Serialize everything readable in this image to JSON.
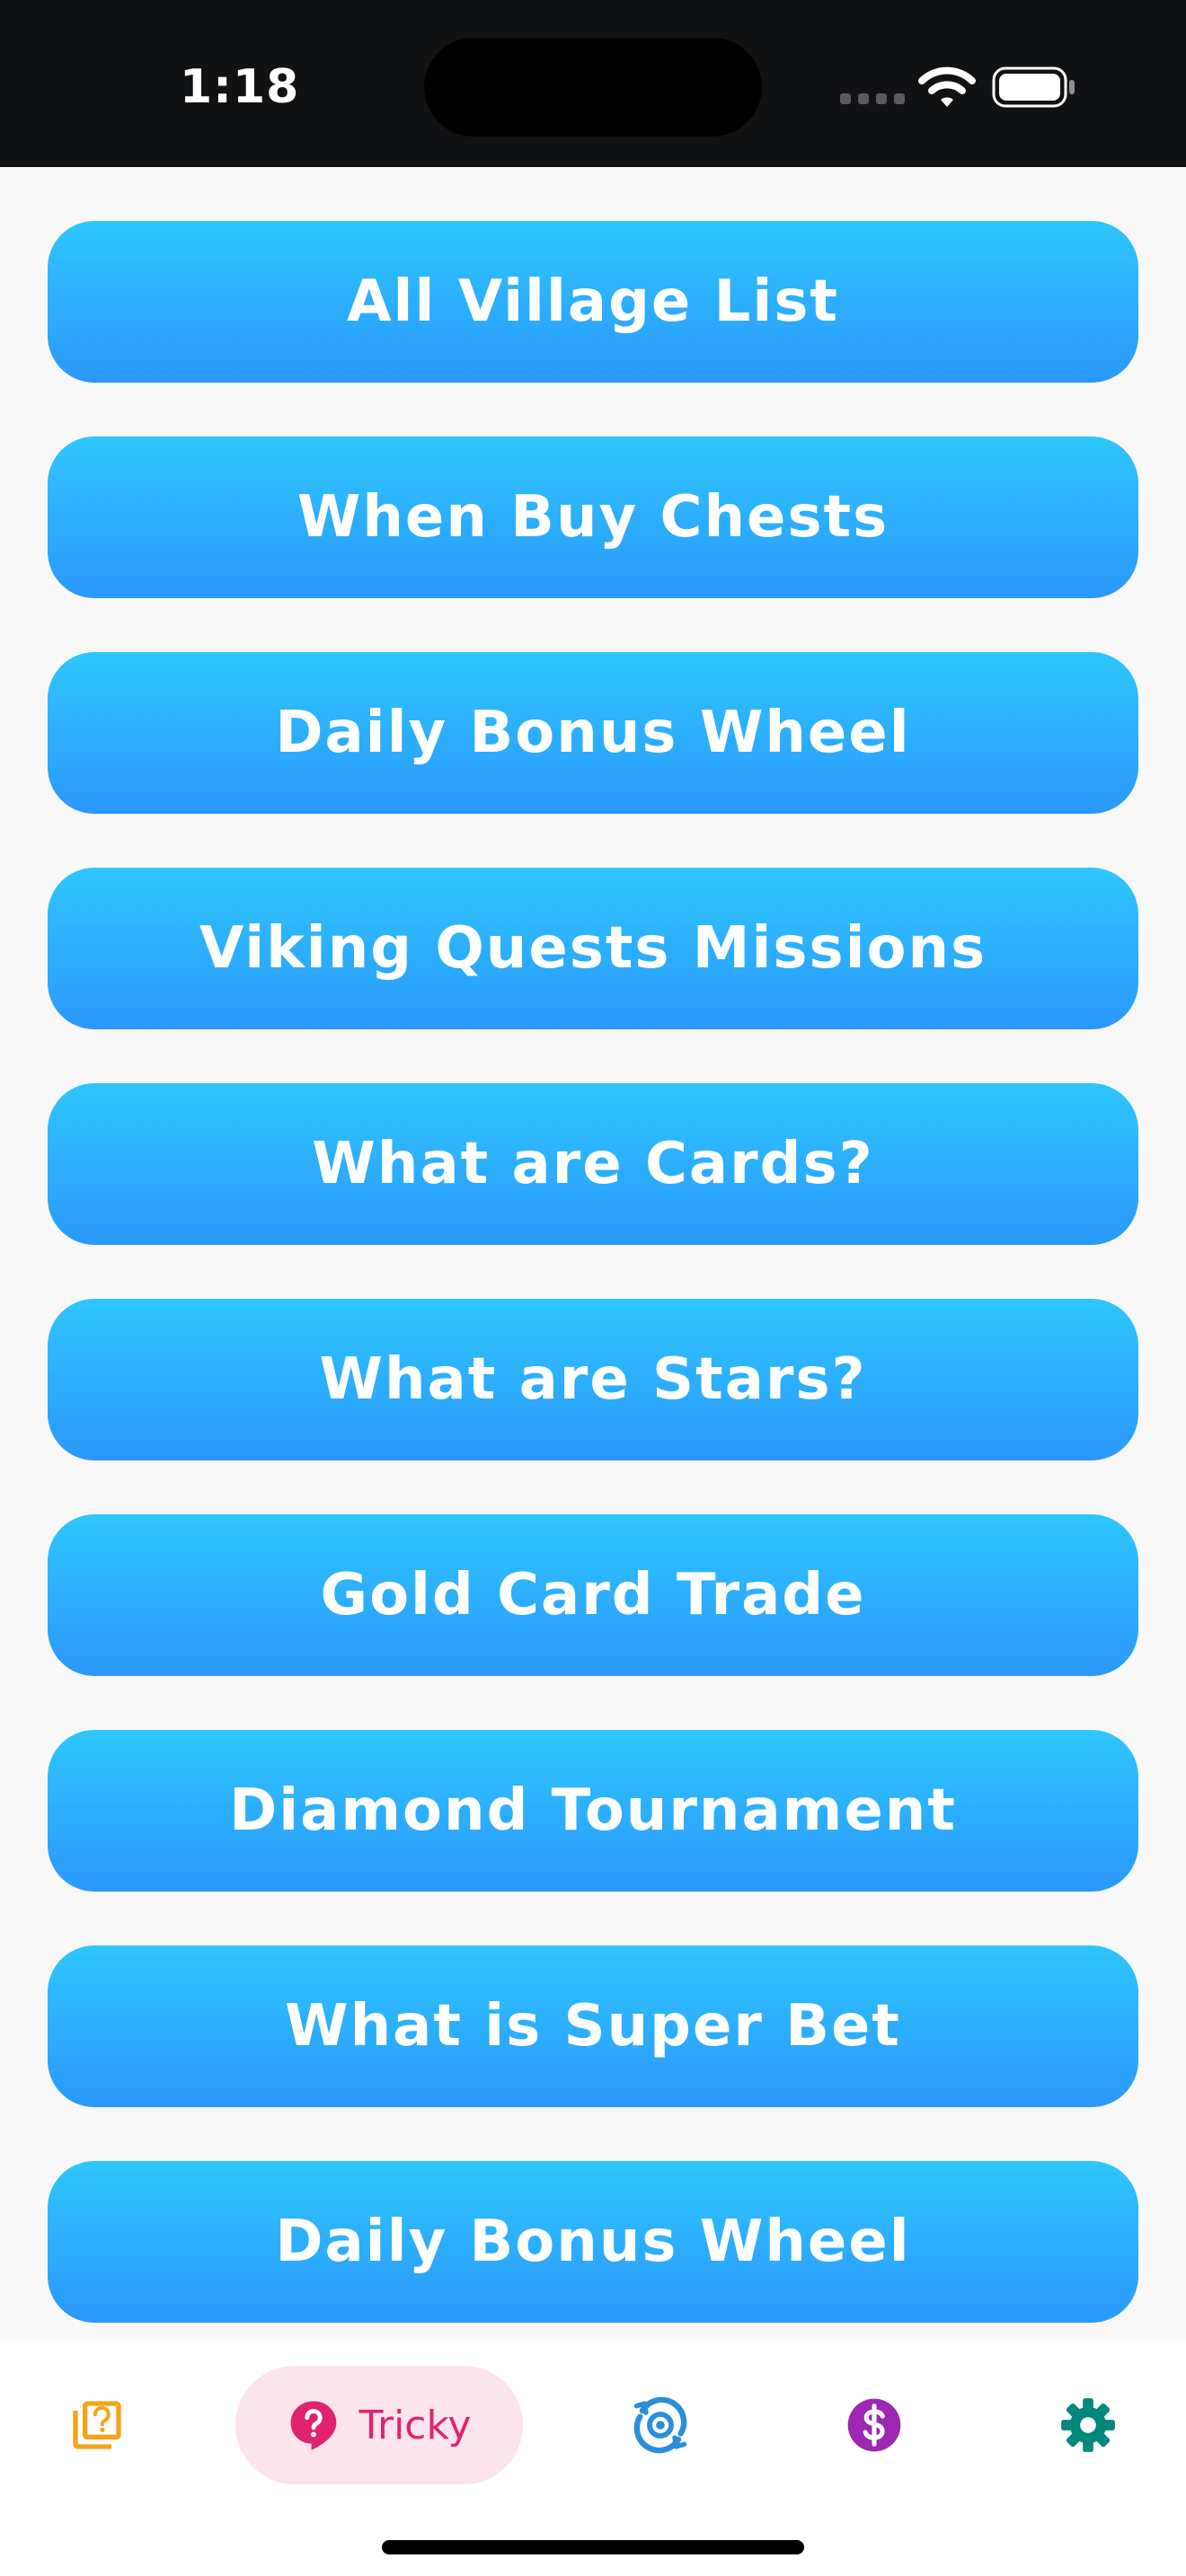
{
  "status_bar": {
    "time": "1:18"
  },
  "menu": {
    "items": [
      {
        "label": "All Village List"
      },
      {
        "label": "When Buy Chests"
      },
      {
        "label": "Daily Bonus Wheel"
      },
      {
        "label": "Viking Quests Missions"
      },
      {
        "label": "What are Cards?"
      },
      {
        "label": "What are Stars?"
      },
      {
        "label": "Gold Card Trade"
      },
      {
        "label": "Diamond Tournament"
      },
      {
        "label": "What is Super Bet"
      },
      {
        "label": "Daily Bonus Wheel"
      }
    ]
  },
  "tab_bar": {
    "tabs": [
      {
        "icon": "question-cards-icon",
        "color": "#F5A31A"
      },
      {
        "icon": "question-bubble-icon",
        "label": "Tricky",
        "color": "#E0236E",
        "active": true
      },
      {
        "icon": "spin-target-icon",
        "color": "#2B8EDB"
      },
      {
        "icon": "dollar-coin-icon",
        "color": "#9C27B0"
      },
      {
        "icon": "gear-icon",
        "color": "#00897B"
      }
    ]
  },
  "colors": {
    "button_gradient_top": "#2EC6FC",
    "button_gradient_bottom": "#2B98FC",
    "background": "#F8F8F8",
    "status_bar": "#111214"
  }
}
